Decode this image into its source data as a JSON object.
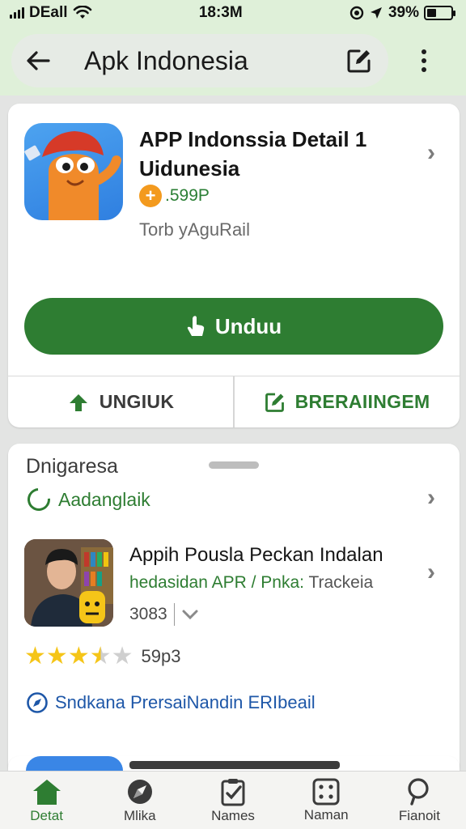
{
  "status_bar": {
    "carrier": "DEall",
    "time": "18:3M",
    "battery": "39%",
    "battery_level": 0.39
  },
  "app_bar": {
    "title": "Apk Indonesia"
  },
  "detail_card": {
    "app_name": "APP Indonssia Detail 1 Uidunesia",
    "coin_symbol": "+",
    "price": ".599P",
    "developer": "Torb yAguRail",
    "download_label": "Unduu",
    "action_left_label": "UNGIUK",
    "action_right_label": "BRERAIINGEM",
    "icon_name": "mascot-app-icon"
  },
  "related_card": {
    "section_title": "Dnigaresa",
    "section_link": "Aadanglaik",
    "item": {
      "title": "Appih Pousla Peckan Indalan",
      "subtitle_green": "hedasidan APR / Pnka:",
      "subtitle_gray": "Trackeia",
      "meta": "3083",
      "rating": 3.5,
      "rating_count": "59p3"
    },
    "footer_link": "Sndkana PrersaiNandin ERIbeail"
  },
  "bottom_nav": {
    "items": [
      {
        "label": "Detat",
        "icon": "home-icon",
        "active": true
      },
      {
        "label": "Mlika",
        "icon": "explore-icon",
        "active": false
      },
      {
        "label": "Names",
        "icon": "clipboard-icon",
        "active": false
      },
      {
        "label": "Naman",
        "icon": "grid-icon",
        "active": false
      },
      {
        "label": "Fianoit",
        "icon": "search-icon",
        "active": false
      }
    ]
  },
  "colors": {
    "accent_green": "#2e7d32",
    "app_bar_bg": "#dff0d9",
    "coin_orange": "#f39a1e",
    "link_blue": "#1e57a8",
    "star_yellow": "#f5c518"
  }
}
